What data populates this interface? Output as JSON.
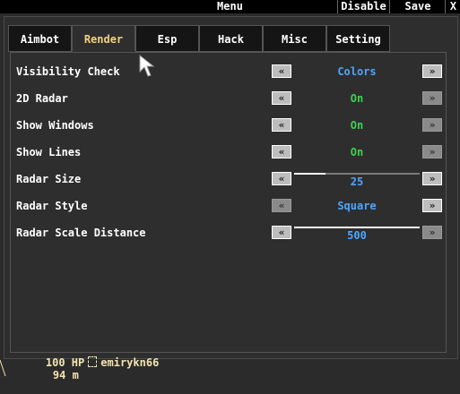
{
  "window": {
    "title": "Menu",
    "disable_label": "Disable",
    "save_label": "Save",
    "close_label": "X"
  },
  "tabs": [
    {
      "label": "Aimbot",
      "active": false
    },
    {
      "label": "Render",
      "active": true
    },
    {
      "label": "Esp",
      "active": false
    },
    {
      "label": "Hack",
      "active": false
    },
    {
      "label": "Misc",
      "active": false
    },
    {
      "label": "Setting",
      "active": false
    }
  ],
  "settings": [
    {
      "label": "Visibility Check",
      "value": "Colors",
      "color": "#4fa6ff"
    },
    {
      "label": "2D Radar",
      "value": "On",
      "color": "#3fd14f"
    },
    {
      "label": "Show Windows",
      "value": "On",
      "color": "#3fd14f"
    },
    {
      "label": "Show Lines",
      "value": "On",
      "color": "#3fd14f"
    },
    {
      "label": "Radar Size",
      "value": "25",
      "color": "#4fa6ff",
      "slider_fraction": 0.25
    },
    {
      "label": "Radar Style",
      "value": "Square",
      "color": "#4fa6ff"
    },
    {
      "label": "Radar Scale Distance",
      "value": "500",
      "color": "#4fa6ff",
      "slider_fraction": 1.0
    }
  ],
  "arrows": {
    "left": "«",
    "right": "»"
  },
  "hud": {
    "hp": "100 HP",
    "player": "emirykn66",
    "distance": "94 m"
  }
}
